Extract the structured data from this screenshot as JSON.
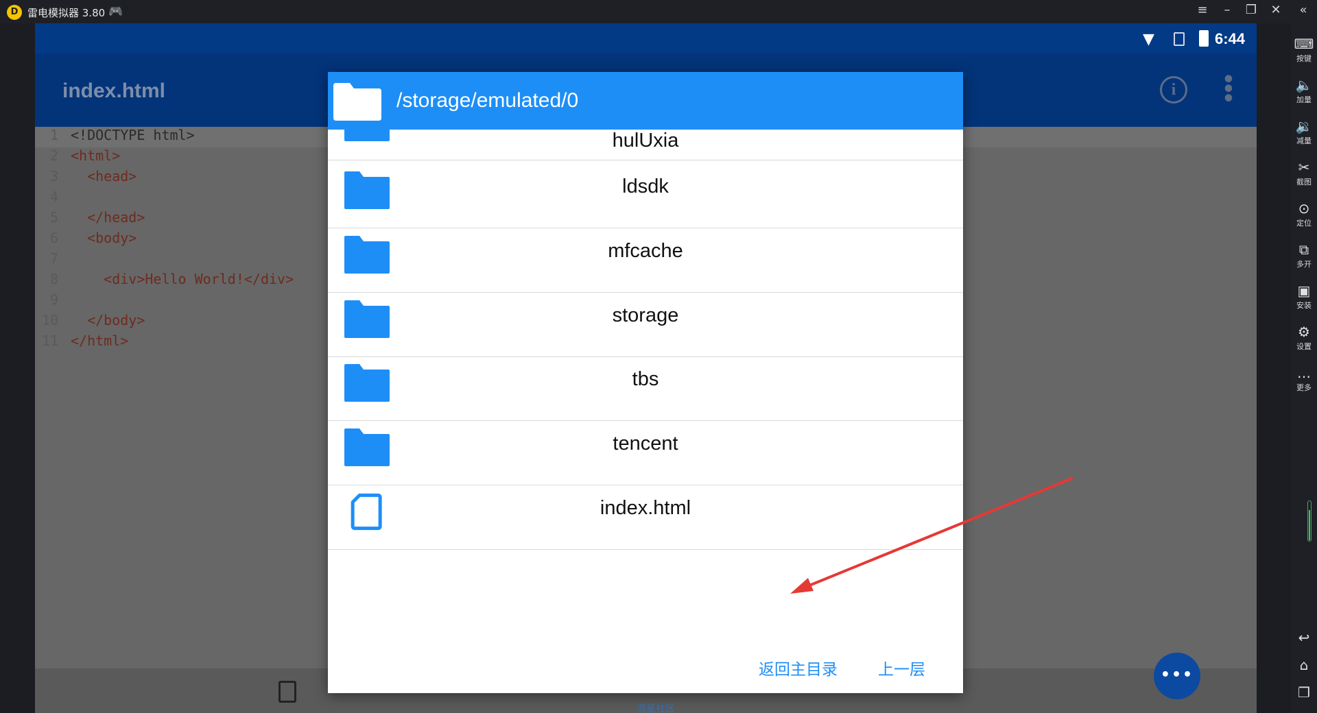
{
  "window": {
    "title": "雷电模拟器 3.80",
    "logo_letter": "D",
    "controls": [
      "menu-icon",
      "minimize-icon",
      "restore-icon",
      "close-icon",
      "collapse-icon"
    ]
  },
  "status_bar": {
    "time": "6:44"
  },
  "app_bar": {
    "title": "index.html",
    "info_icon": "i",
    "more_icon": "⋮"
  },
  "editor": {
    "lines": [
      {
        "num": "1",
        "text": "<!DOCTYPE html>",
        "kind": "plain"
      },
      {
        "num": "2",
        "text": "<html>",
        "kind": "tag"
      },
      {
        "num": "3",
        "text": "  <head>",
        "kind": "tag"
      },
      {
        "num": "4",
        "text": "",
        "kind": "plain"
      },
      {
        "num": "5",
        "text": "  </head>",
        "kind": "tag"
      },
      {
        "num": "6",
        "text": "  <body>",
        "kind": "tag"
      },
      {
        "num": "7",
        "text": "",
        "kind": "plain"
      },
      {
        "num": "8",
        "text": "    <div>Hello World!</div>",
        "kind": "tag"
      },
      {
        "num": "9",
        "text": "",
        "kind": "plain"
      },
      {
        "num": "10",
        "text": "  </body>",
        "kind": "tag"
      },
      {
        "num": "11",
        "text": "</html>",
        "kind": "tag"
      }
    ]
  },
  "bottom_bar": {
    "watermark": "流星社区",
    "fab_label": "•••"
  },
  "dialog": {
    "path": "/storage/emulated/0",
    "items": [
      {
        "name": "hulUxia",
        "type": "folder"
      },
      {
        "name": "ldsdk",
        "type": "folder"
      },
      {
        "name": "mfcache",
        "type": "folder"
      },
      {
        "name": "storage",
        "type": "folder"
      },
      {
        "name": "tbs",
        "type": "folder"
      },
      {
        "name": "tencent",
        "type": "folder"
      },
      {
        "name": "index.html",
        "type": "file"
      }
    ],
    "home_button": "返回主目录",
    "up_button": "上一层"
  },
  "side_toolbar": {
    "items": [
      {
        "label": "按键",
        "icon": "keyboard-icon",
        "glyph": "⌨"
      },
      {
        "label": "加量",
        "icon": "volume-up-icon",
        "glyph": "🔈"
      },
      {
        "label": "减量",
        "icon": "volume-down-icon",
        "glyph": "🔉"
      },
      {
        "label": "截图",
        "icon": "scissors-icon",
        "glyph": "✂"
      },
      {
        "label": "定位",
        "icon": "location-icon",
        "glyph": "⊙"
      },
      {
        "label": "多开",
        "icon": "multi-instance-icon",
        "glyph": "⧉"
      },
      {
        "label": "安装",
        "icon": "apk-install-icon",
        "glyph": "▣"
      },
      {
        "label": "设置",
        "icon": "gear-icon",
        "glyph": "⚙"
      },
      {
        "label": "更多",
        "icon": "more-icon",
        "glyph": "…"
      }
    ],
    "nav": [
      {
        "icon": "back-icon",
        "glyph": "↩"
      },
      {
        "icon": "home-icon",
        "glyph": "⌂"
      },
      {
        "icon": "recents-icon",
        "glyph": "❐"
      }
    ]
  },
  "colors": {
    "accent": "#1e8ef7",
    "app_bar": "#03347a",
    "status_bar": "#023a86",
    "annotation_arrow": "#e53935"
  }
}
